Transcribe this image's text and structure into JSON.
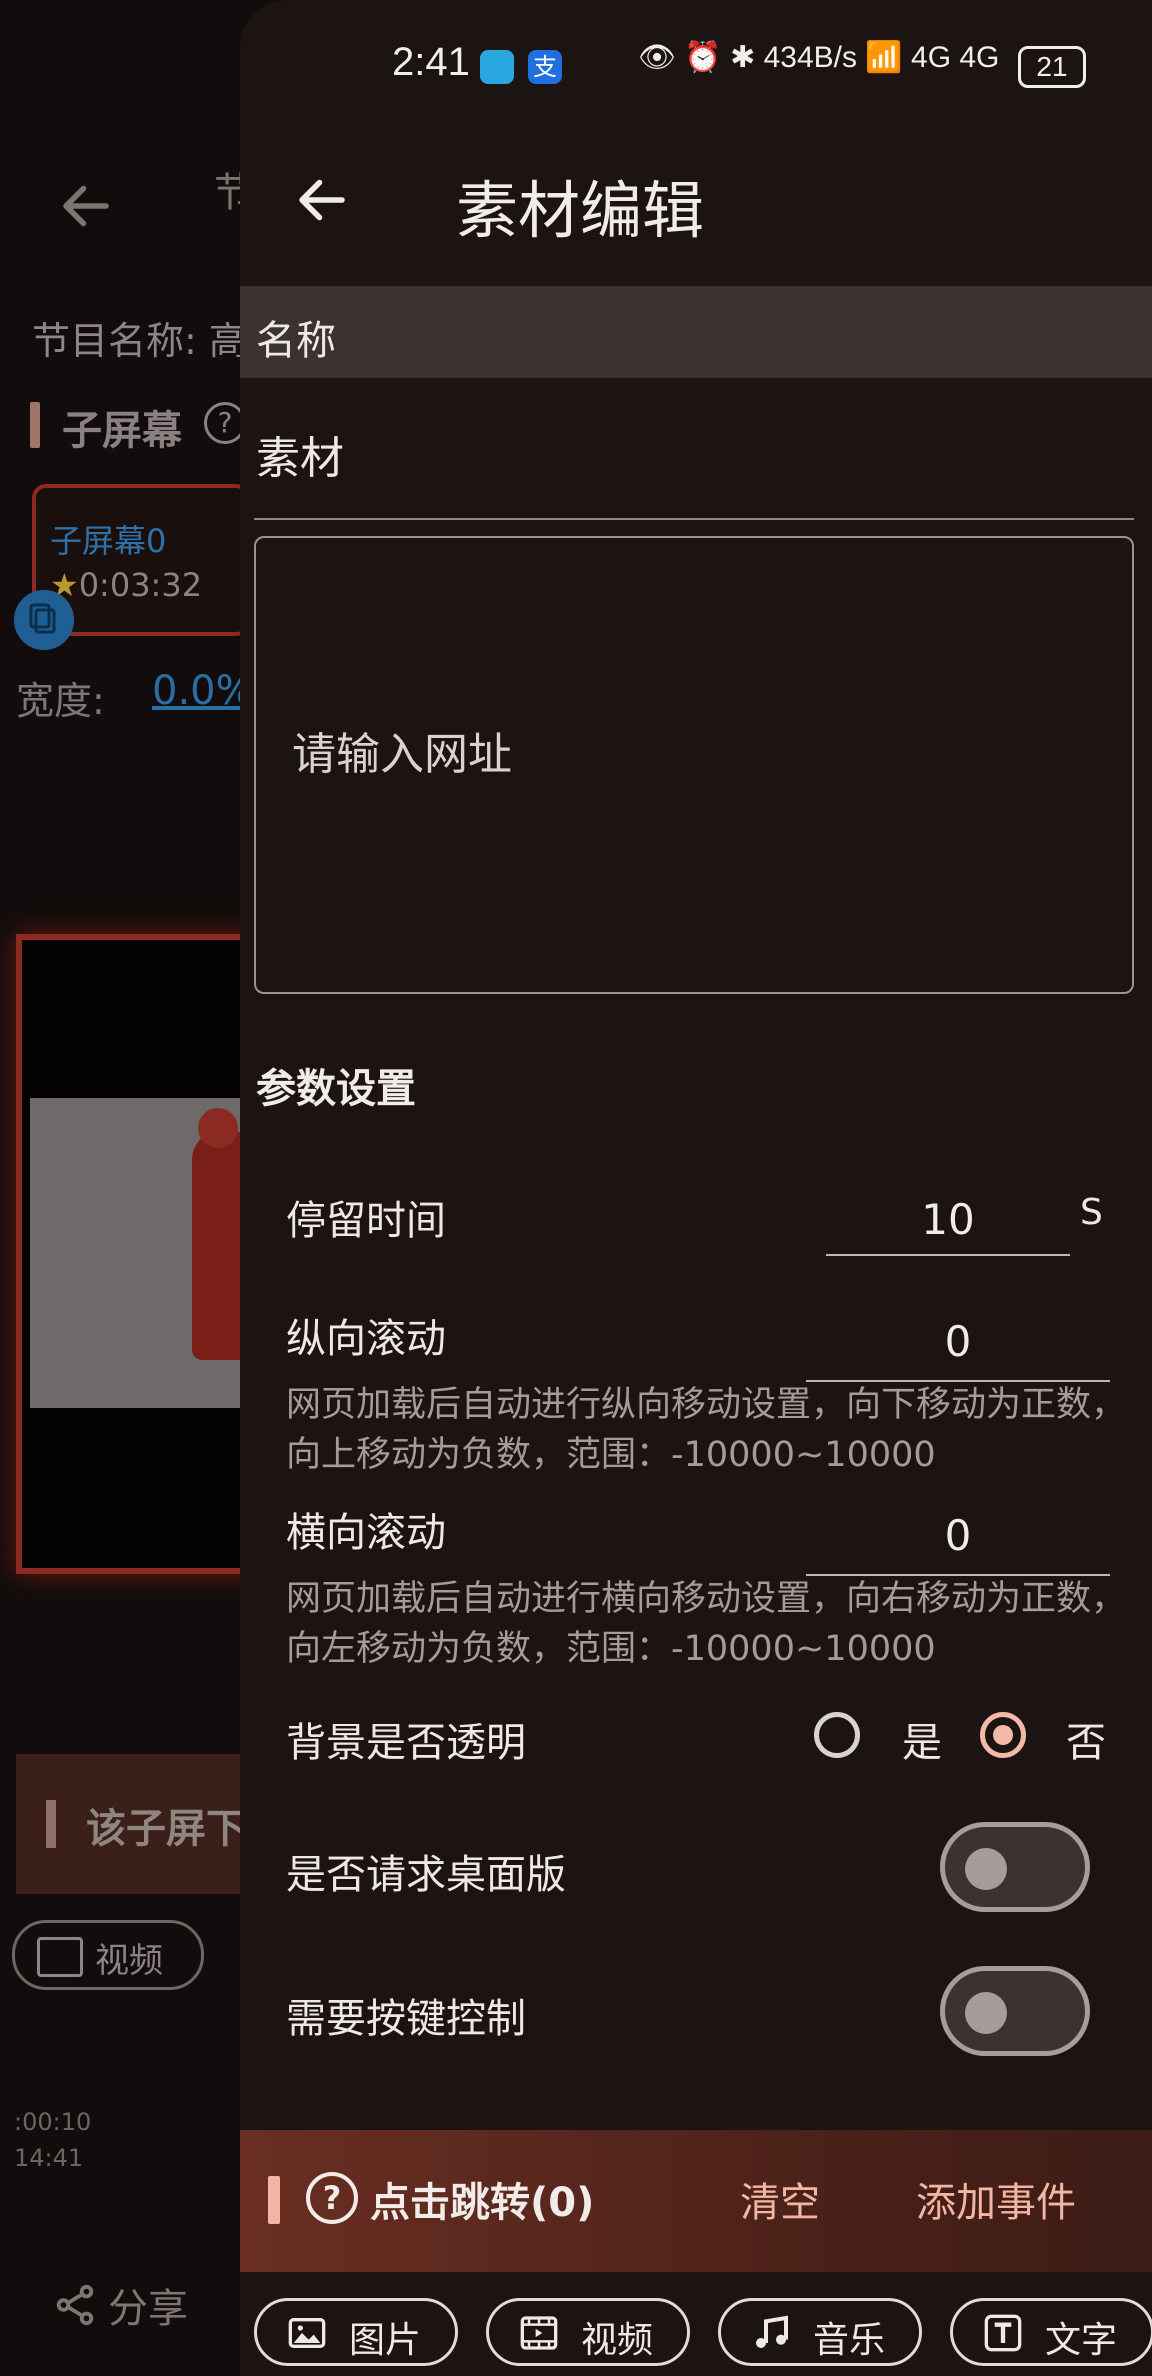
{
  "status_bar": {
    "time": "2:41",
    "alipay_icon_text": "支",
    "indicators": "👁 ⏰ ✱ 434B/s 📶 4G 4G",
    "battery": "21"
  },
  "background_page": {
    "title_fragment": "节",
    "program_name_label": "节目名称: 高",
    "sub_screen_title": "子屏幕",
    "sub_screen_card_name": "子屏幕0",
    "sub_screen_card_time": "0:03:32",
    "width_label": "宽度:",
    "width_value": "0.0%",
    "section_title": "该子屏下",
    "video_chip": "视频",
    "time1": ":00:10",
    "time2": "14:41",
    "share": "分享"
  },
  "drawer": {
    "title": "素材编辑",
    "name_label": "名称",
    "material_label": "素材",
    "url_placeholder": "请输入网址",
    "params_title": "参数设置",
    "stay_time": {
      "label": "停留时间",
      "value": "10",
      "unit": "S"
    },
    "vertical_scroll": {
      "label": "纵向滚动",
      "value": "0",
      "hint": "网页加载后自动进行纵向移动设置，向下移动为正数，向上移动为负数，范围：-10000~10000"
    },
    "horizontal_scroll": {
      "label": "横向滚动",
      "value": "0",
      "hint": "网页加载后自动进行横向移动设置，向右移动为正数，向左移动为负数，范围：-10000~10000"
    },
    "transparent_bg": {
      "label": "背景是否透明",
      "yes": "是",
      "no": "否",
      "selected": "否"
    },
    "desktop_version": {
      "label": "是否请求桌面版",
      "on": false
    },
    "key_control": {
      "label": "需要按键控制",
      "on": false
    },
    "event_bar": {
      "label": "点击跳转(0)",
      "clear": "清空",
      "add": "添加事件"
    },
    "chips": [
      {
        "label": "图片",
        "icon": "image-icon"
      },
      {
        "label": "视频",
        "icon": "video-icon"
      },
      {
        "label": "音乐",
        "icon": "music-icon"
      },
      {
        "label": "文字",
        "icon": "text-icon"
      }
    ]
  },
  "colors": {
    "drawer_bg": "#1c1413",
    "accent": "#f3b6a4",
    "event_bar": "#5a281e"
  }
}
